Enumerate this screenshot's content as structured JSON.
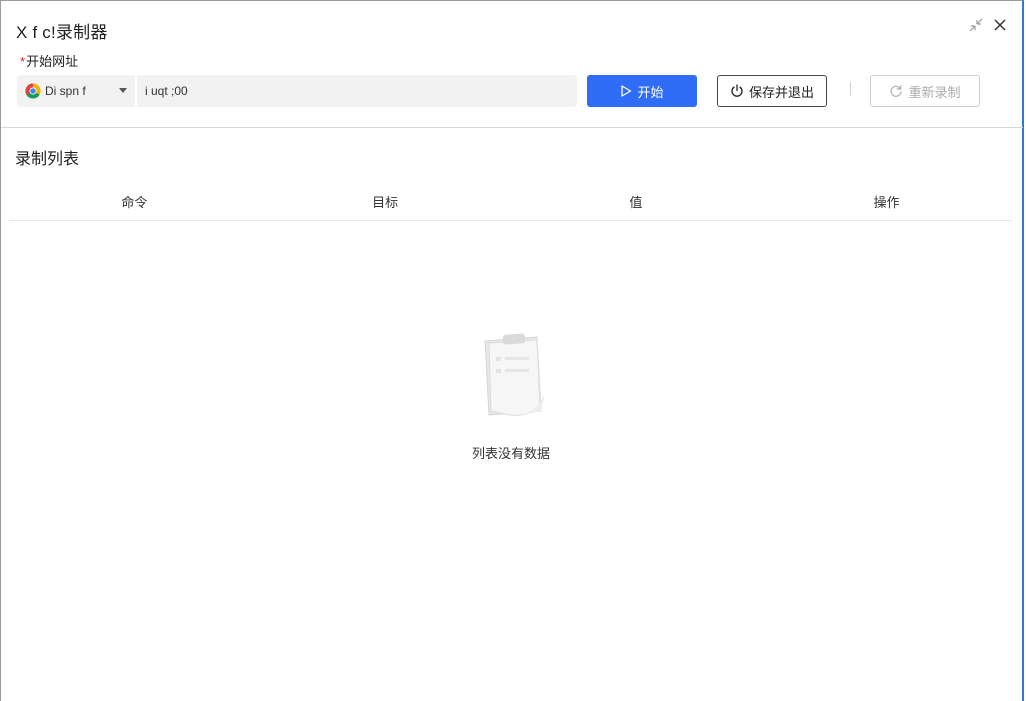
{
  "window": {
    "title": "X f c!录制器"
  },
  "form": {
    "required_mark": "*",
    "url_label": "开始网址",
    "browser_name": "Di spn f",
    "url_value": "i uqt ;00"
  },
  "toolbar": {
    "start_label": "开始",
    "save_exit_label": "保存并退出",
    "rerecord_label": "重新录制"
  },
  "recording_list": {
    "title": "录制列表",
    "columns": [
      "命令",
      "目标",
      "值",
      "操作"
    ],
    "rows": [],
    "empty_text": "列表没有数据"
  },
  "colors": {
    "primary": "#2f6df6",
    "window_border_accent": "#2b7bd4",
    "required_mark": "#e02020",
    "disabled_text": "#aaaaaa"
  },
  "icons": {
    "shrink": "shrink-arrows-icon",
    "close": "close-icon",
    "browser": "chrome-icon",
    "start": "play-triangle-icon",
    "save_exit": "power-icon",
    "rerecord": "refresh-icon",
    "empty": "clipboard-empty-icon"
  }
}
